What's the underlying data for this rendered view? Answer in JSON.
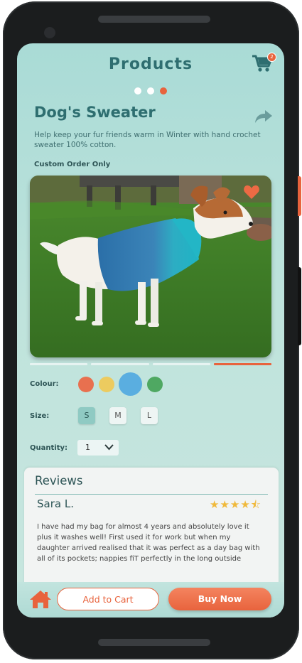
{
  "header": {
    "title": "Products",
    "cart_badge": "2"
  },
  "carousel": {
    "dots": 3,
    "active": 2
  },
  "product": {
    "title": "Dog's Sweater",
    "description": "Help keep your fur friends warm in Winter with hand crochet sweater 100% cotton.",
    "note": "Custom Order Only"
  },
  "options": {
    "colour_label": "Colour:",
    "colours": [
      "#e8704f",
      "#eccb5f",
      "#5aaee0",
      "#4fa862"
    ],
    "selected_colour": 2,
    "size_label": "Size:",
    "sizes": [
      "S",
      "M",
      "L"
    ],
    "selected_size": "S",
    "quantity_label": "Quantity:",
    "quantity": "1"
  },
  "reviews": {
    "title": "Reviews",
    "items": [
      {
        "name": "Sara L.",
        "rating": 4.5,
        "stars_text": "★★★★⯪",
        "text": "I have had my bag for almost 4 years and absolutely love it plus it washes well! First used it for work but when my daughter arrived realised that it was perfect as a day bag with all of its pockets; nappies fiT perfectly in the long outside pocket, changing bottle, treats etc."
      }
    ]
  },
  "actions": {
    "add_to_cart": "Add to Cart",
    "buy_now": "Buy Now"
  },
  "colors": {
    "accent": "#e8633d",
    "teal": "#2e6e70",
    "background": "#a9dbd6"
  }
}
